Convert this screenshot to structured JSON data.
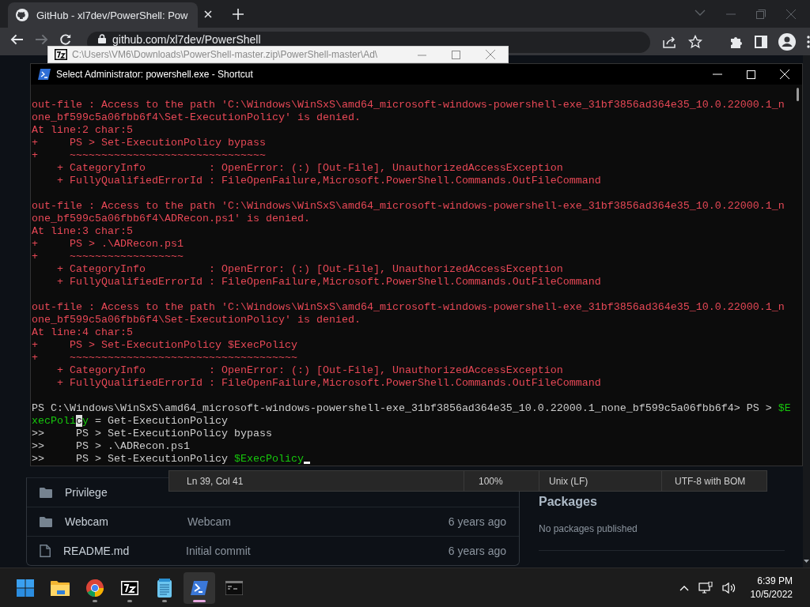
{
  "browser": {
    "tab": {
      "title": "GitHub - xl7dev/PowerShell: Pow",
      "selected": true
    },
    "address": "github.com/xl7dev/PowerShell"
  },
  "github": {
    "files": [
      {
        "kind": "folder",
        "name": "Privilege"
      },
      {
        "kind": "folder",
        "name": "Webcam",
        "message": "Webcam",
        "age": "6 years ago"
      },
      {
        "kind": "file",
        "name": "README.md",
        "message": "Initial commit",
        "age": "6 years ago"
      }
    ],
    "sidebar": {
      "heading": "Packages",
      "text": "No packages published"
    }
  },
  "zip_window": {
    "title": "C:\\Users\\VM6\\Downloads\\PowerShell-master.zip\\PowerShell-master\\Ad\\"
  },
  "terminal": {
    "title": "Select Administrator: powershell.exe - Shortcut",
    "blocks": [
      {
        "lines": [
          {
            "kind": "error",
            "text": "out-file : Access to the path 'C:\\Windows\\WinSxS\\amd64_microsoft-windows-powershell-exe_31bf3856ad364e35_10.0.22000.1_n"
          },
          {
            "kind": "error",
            "text": "one_bf599c5a06fbb6f4\\Set-ExecutionPolicy' is denied."
          },
          {
            "kind": "error",
            "text": "At line:2 char:5"
          },
          {
            "kind": "error",
            "text": "+     PS > Set-ExecutionPolicy bypass"
          },
          {
            "kind": "error",
            "text": "+     ~~~~~~~~~~~~~~~~~~~~~~~~~~~~~~~"
          },
          {
            "kind": "error",
            "text": "    + CategoryInfo          : OpenError: (:) [Out-File], UnauthorizedAccessException"
          },
          {
            "kind": "error",
            "text": "    + FullyQualifiedErrorId : FileOpenFailure,Microsoft.PowerShell.Commands.OutFileCommand"
          }
        ]
      },
      {
        "lines": [
          {
            "kind": "error",
            "text": "out-file : Access to the path 'C:\\Windows\\WinSxS\\amd64_microsoft-windows-powershell-exe_31bf3856ad364e35_10.0.22000.1_n"
          },
          {
            "kind": "error",
            "text": "one_bf599c5a06fbb6f4\\ADRecon.ps1' is denied."
          },
          {
            "kind": "error",
            "text": "At line:3 char:5"
          },
          {
            "kind": "error",
            "text": "+     PS > .\\ADRecon.ps1"
          },
          {
            "kind": "error",
            "text": "+     ~~~~~~~~~~~~~~~~~~"
          },
          {
            "kind": "error",
            "text": "    + CategoryInfo          : OpenError: (:) [Out-File], UnauthorizedAccessException"
          },
          {
            "kind": "error",
            "text": "    + FullyQualifiedErrorId : FileOpenFailure,Microsoft.PowerShell.Commands.OutFileCommand"
          }
        ]
      },
      {
        "lines": [
          {
            "kind": "error",
            "text": "out-file : Access to the path 'C:\\Windows\\WinSxS\\amd64_microsoft-windows-powershell-exe_31bf3856ad364e35_10.0.22000.1_n"
          },
          {
            "kind": "error",
            "text": "one_bf599c5a06fbb6f4\\Set-ExecutionPolicy' is denied."
          },
          {
            "kind": "error",
            "text": "At line:4 char:5"
          },
          {
            "kind": "error",
            "text": "+     PS > Set-ExecutionPolicy $ExecPolicy"
          },
          {
            "kind": "error",
            "text": "+     ~~~~~~~~~~~~~~~~~~~~~~~~~~~~~~~~~~~~"
          },
          {
            "kind": "error",
            "text": "    + CategoryInfo          : OpenError: (:) [Out-File], UnauthorizedAccessException"
          },
          {
            "kind": "error",
            "text": "    + FullyQualifiedErrorId : FileOpenFailure,Microsoft.PowerShell.Commands.OutFileCommand"
          }
        ]
      },
      {
        "lines": [
          {
            "segments": [
              {
                "kind": "plain",
                "text": "PS C:\\Windows\\WinSxS\\amd64_microsoft-windows-powershell-exe_31bf3856ad364e35_10.0.22000.1_none_bf599c5a06fbb6f4> PS > "
              },
              {
                "kind": "variable",
                "text": "$E"
              }
            ]
          },
          {
            "segments": [
              {
                "kind": "variable",
                "text": "xecPoli"
              },
              {
                "kind": "highlight",
                "text": "c"
              },
              {
                "kind": "variable",
                "text": "y"
              },
              {
                "kind": "plain",
                "text": " = Get-ExecutionPolicy"
              }
            ]
          },
          {
            "kind": "plain",
            "text": ">>     PS > Set-ExecutionPolicy bypass"
          },
          {
            "kind": "plain",
            "text": ">>     PS > .\\ADRecon.ps1"
          },
          {
            "segments": [
              {
                "kind": "plain",
                "text": ">>     PS > Set-ExecutionPolicy "
              },
              {
                "kind": "variable",
                "text": "$ExecPolicy"
              }
            ]
          }
        ]
      }
    ]
  },
  "notepad_status": [
    "Ln 39, Col 41",
    "100%",
    "Unix (LF)",
    "UTF-8 with BOM"
  ],
  "taskbar": {
    "apps": [
      {
        "kind": "start",
        "running": false,
        "selected": false
      },
      {
        "kind": "explorer",
        "running": false,
        "selected": false
      },
      {
        "kind": "browser",
        "running": true,
        "selected": false
      },
      {
        "kind": "archiver",
        "running": true,
        "selected": false
      },
      {
        "kind": "notepad",
        "running": true,
        "selected": false
      },
      {
        "kind": "powershell",
        "running": true,
        "selected": true
      },
      {
        "kind": "console",
        "running": false,
        "selected": false
      }
    ],
    "time": "6:39 PM",
    "date": "10/5/2022"
  }
}
